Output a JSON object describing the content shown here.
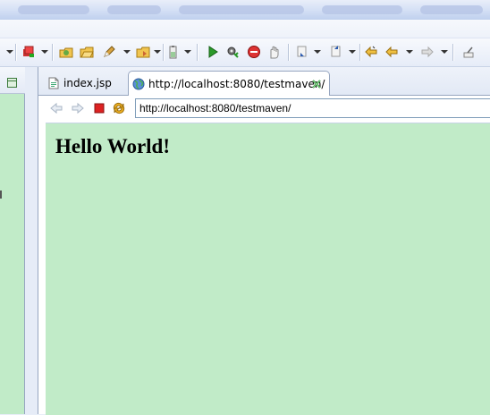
{
  "editor": {
    "tabs": [
      {
        "label": "index.jsp",
        "icon": "jsp-file-icon",
        "active": false
      },
      {
        "label": "http://localhost:8080/testmaven/",
        "icon": "globe-icon",
        "active": true
      }
    ]
  },
  "browser": {
    "url": "http://localhost:8080/testmaven/",
    "page_heading": "Hello World!",
    "page_background": "#c1ebc8"
  },
  "toolbar": {
    "icons": [
      "server-stop-icon",
      "open-type-icon",
      "open-folder-icon",
      "pencil-icon",
      "open-task-icon",
      "battery-icon",
      "run-icon",
      "debug-gear-icon",
      "stop-icon",
      "hand-icon",
      "next-annotation-icon",
      "prev-annotation-icon",
      "last-edit-icon",
      "back-icon",
      "forward-icon",
      "pin-editor-icon"
    ]
  }
}
